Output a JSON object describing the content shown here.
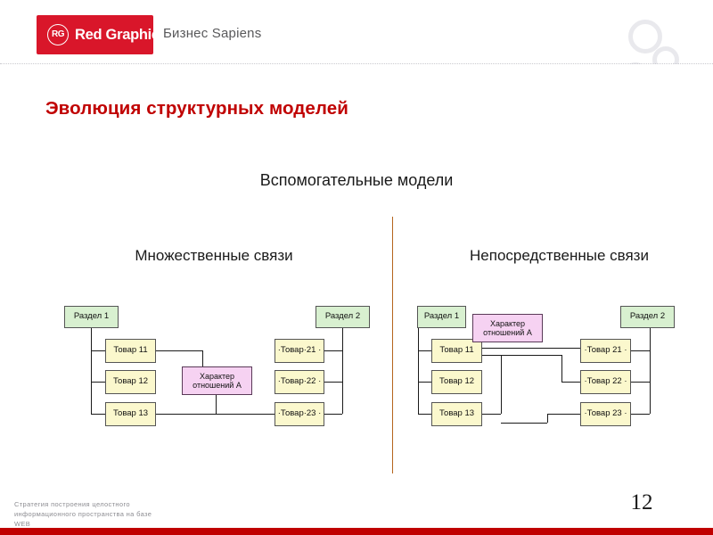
{
  "header": {
    "logo_mark": "RG",
    "logo_text": "Red Graphic",
    "brand_text": "Бизнес Sapiens"
  },
  "page_title": "Эволюция структурных моделей",
  "subtitle": "Вспомогательные модели",
  "columns": {
    "left_title": "Множественные связи",
    "right_title": "Непосредственные связи"
  },
  "diagram_left": {
    "section_1": "Раздел 1",
    "section_2": "Раздел 2",
    "items_left": [
      "Товар 11",
      "Товар 12",
      "Товар 13"
    ],
    "items_right": [
      "·Товар·21 ·",
      "·Товар·22 ·",
      "·Товар·23 ·"
    ],
    "relation": "Характер отношений А"
  },
  "diagram_right": {
    "section_1": "Раздел 1",
    "section_2": "Раздел 2",
    "items_left": [
      "Товар 11",
      "Товар 12",
      "Товар 13"
    ],
    "items_right": [
      "·Товар 21 ·",
      "·Товар 22 ·",
      "·Товар 23 ·"
    ],
    "relation": "Характер отношений А"
  },
  "footer": {
    "line1": "Стратегия построения целостного",
    "line2": "информационного пространства на базе",
    "line3": "WEB",
    "page_number": "12"
  },
  "colors": {
    "brand_red": "#d9162a",
    "title_red": "#c00000",
    "section_green": "#d8f0d0",
    "item_yellow": "#fbf8cd",
    "relation_pink": "#f6d2f2",
    "divider_brown": "#b5651d"
  }
}
